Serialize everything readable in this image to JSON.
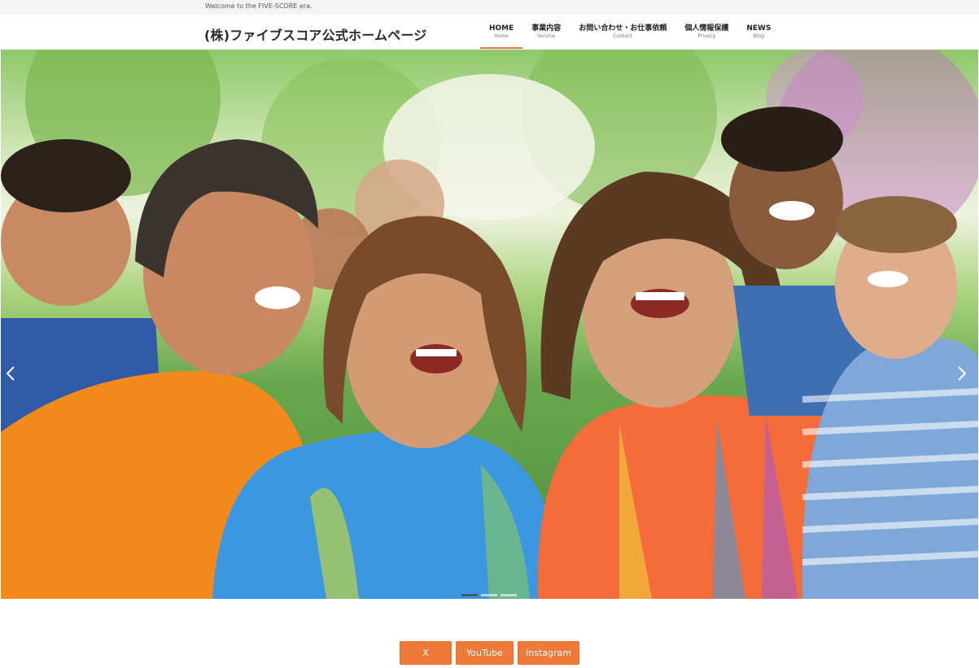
{
  "topbar": {
    "tagline": "Welcome to the FIVE-SCORE era."
  },
  "header": {
    "site_title": "(株)ファイブスコア公式ホームページ",
    "nav": [
      {
        "label": "HOME",
        "sub": "Home",
        "active": true
      },
      {
        "label": "事業内容",
        "sub": "Service",
        "active": false
      },
      {
        "label": "お問い合わせ・お仕事依頼",
        "sub": "Contact",
        "active": false
      },
      {
        "label": "個人情報保護",
        "sub": "Privacy",
        "active": false
      },
      {
        "label": "NEWS",
        "sub": "Blog",
        "active": false
      }
    ],
    "accent_color": "#e8764a"
  },
  "hero": {
    "image_alt": "",
    "slide_count": 3,
    "active_slide": 1,
    "prev_icon": "chevron-left-icon",
    "next_icon": "chevron-right-icon"
  },
  "social": {
    "buttons": [
      {
        "label": "X"
      },
      {
        "label": "YouTube"
      },
      {
        "label": "Instagram"
      }
    ],
    "color": "#ee7a3a"
  }
}
